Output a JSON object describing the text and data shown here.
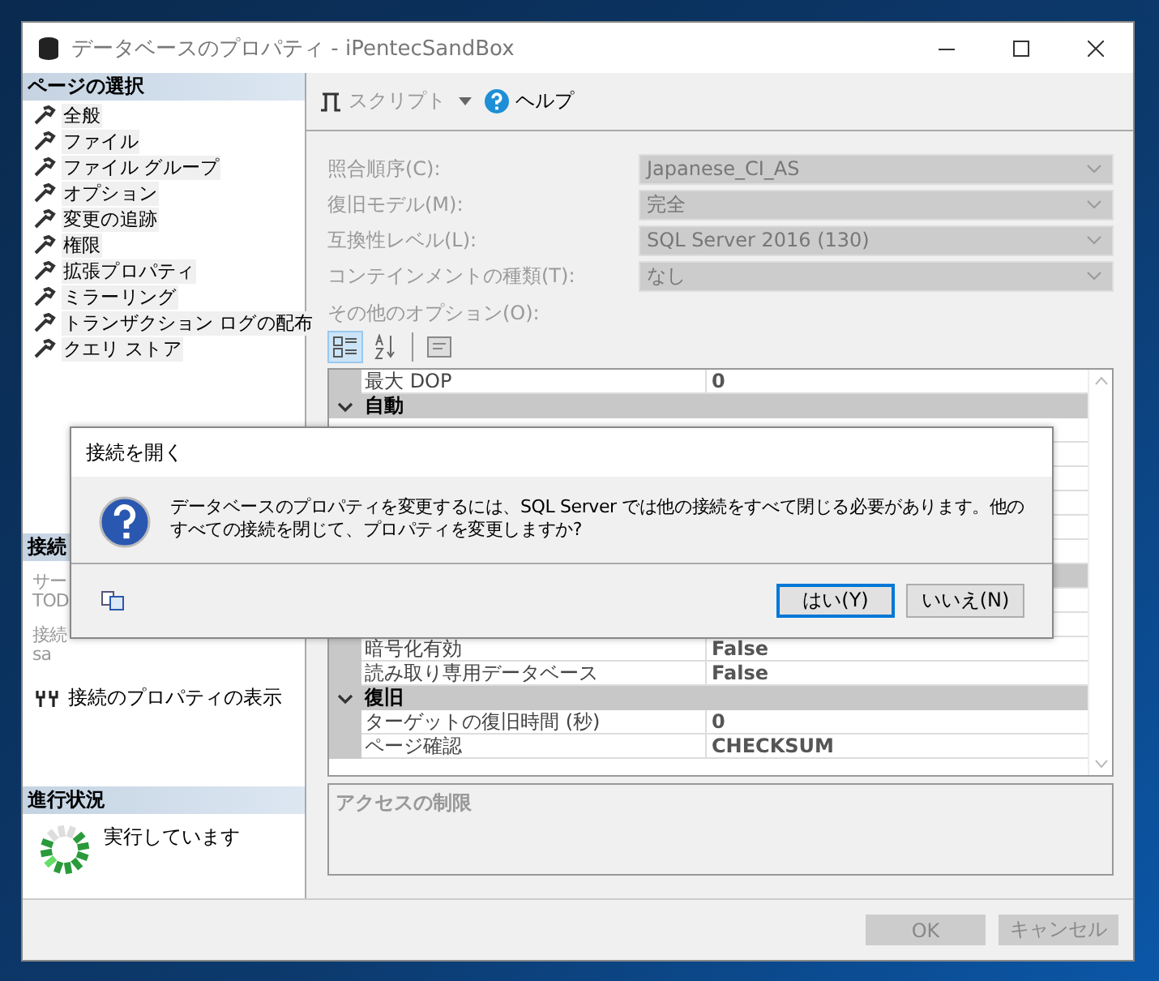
{
  "window": {
    "title": "データベースのプロパティ - iPentecSandBox"
  },
  "sidebar": {
    "page_select": {
      "title": "ページの選択",
      "items": [
        {
          "label": "全般"
        },
        {
          "label": "ファイル"
        },
        {
          "label": "ファイル グループ"
        },
        {
          "label": "オプション"
        },
        {
          "label": "変更の追跡"
        },
        {
          "label": "権限"
        },
        {
          "label": "拡張プロパティ"
        },
        {
          "label": "ミラーリング"
        },
        {
          "label": "トランザクション ログの配布"
        },
        {
          "label": "クエリ ストア"
        }
      ]
    },
    "connection": {
      "title": "接続",
      "lines": [
        "サー",
        "TOD",
        "接続",
        "sa"
      ],
      "link": "接続のプロパティの表示"
    },
    "progress": {
      "title": "進行状況",
      "status": "実行しています"
    }
  },
  "toolbar": {
    "script": {
      "label": "スクリプト",
      "disabled": true
    },
    "help": {
      "label": "ヘルプ"
    }
  },
  "form": {
    "fields": [
      {
        "label": "照合順序(C):",
        "value": "Japanese_CI_AS",
        "disabled": true
      },
      {
        "label": "復旧モデル(M):",
        "value": "完全",
        "disabled": true
      },
      {
        "label": "互換性レベル(L):",
        "value": "SQL Server 2016 (130)",
        "disabled": true
      },
      {
        "label": "コンテインメントの種類(T):",
        "value": "なし",
        "disabled": true
      }
    ],
    "other_options": "その他のオプション(O):"
  },
  "grid_toolbar": [
    {
      "kind": "categorized",
      "selected": true
    },
    {
      "kind": "alphabetical",
      "selected": false
    },
    {
      "kind": "property_pages",
      "selected": false
    }
  ],
  "grid": {
    "rows_top": [
      {
        "kind": "property",
        "name": "最大 DOP",
        "value": "0"
      },
      {
        "kind": "category",
        "name": "自動",
        "expanded": true
      }
    ],
    "rows_bottom": [
      {
        "kind": "property",
        "name": "暗号化有効",
        "value": "False"
      },
      {
        "kind": "property",
        "name": "読み取り専用データベース",
        "value": "False"
      },
      {
        "kind": "category",
        "name": "復旧",
        "expanded": true
      },
      {
        "kind": "property",
        "name": "ターゲットの復旧時間 (秒)",
        "value": "0"
      },
      {
        "kind": "property",
        "name": "ページ確認",
        "value": "CHECKSUM"
      }
    ]
  },
  "description": {
    "title": "アクセスの制限"
  },
  "buttons": [
    {
      "label": "OK",
      "disabled": true
    },
    {
      "label": "キャンセル",
      "disabled": true
    }
  ],
  "dialog": {
    "title": "接続を開く",
    "message": "データベースのプロパティを変更するには、SQL Server では他の接続をすべて閉じる必要があります。他のすべての接続を閉じて、プロパティを変更しますか?",
    "buttons": [
      {
        "label": "はい(Y)",
        "selected": true
      },
      {
        "label": "いいえ(N)",
        "selected": false
      }
    ]
  }
}
